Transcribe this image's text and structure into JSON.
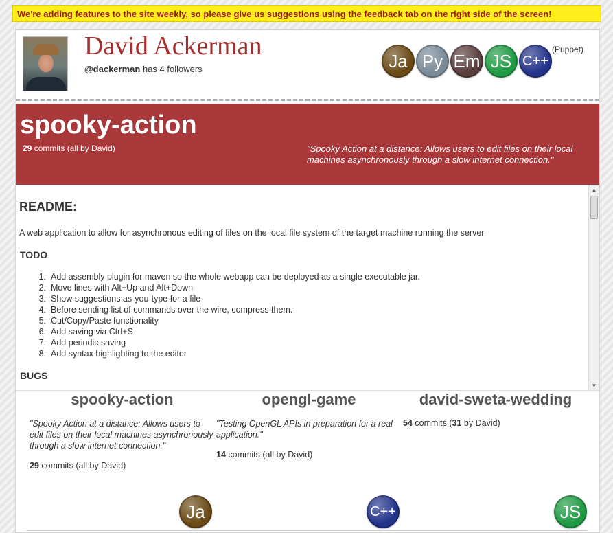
{
  "banner": {
    "text": "We're adding features to the site weekly, so please give us suggestions using the feedback tab on the right side of the screen!"
  },
  "profile": {
    "name": "David Ackerman",
    "handle": "@dackerman",
    "followers_text": " has 4 followers",
    "languages": [
      {
        "abbr": "Ja",
        "color": "#6b4a16"
      },
      {
        "abbr": "Py",
        "color": "#7a8a97"
      },
      {
        "abbr": "Em",
        "color": "#5a3e3e"
      },
      {
        "abbr": "JS",
        "color": "#1f9a44"
      },
      {
        "abbr": "C++",
        "color": "#23338a"
      }
    ],
    "extra_language": "(Puppet)"
  },
  "repo": {
    "title": "spooky-action",
    "commit_count": "29",
    "commits_text": " commits (all by David)",
    "description": "\"Spooky Action at a distance: Allows users to edit files on their local machines asynchronously through a slow internet connection.\""
  },
  "readme": {
    "heading": "README:",
    "intro": "A web application to allow for asynchronous editing of files on the local file system of the target machine running the server",
    "todo_heading": "TODO",
    "todo_items": [
      "Add assembly plugin for maven so the whole webapp can be deployed as a single executable jar.",
      "Move lines with Alt+Up and Alt+Down",
      "Show suggestions as-you-type for a file",
      "Before sending list of commands over the wire, compress them.",
      "Cut/Copy/Paste functionality",
      "Add saving via Ctrl+S",
      "Add periodic saving",
      "Add syntax highlighting to the editor"
    ],
    "bugs_heading": "BUGS"
  },
  "repo_cards": [
    {
      "title": "spooky-action",
      "description": "\"Spooky Action at a distance: Allows users to edit files on their local machines asynchronously through a slow internet connection.\"",
      "commit_count": "29",
      "commits_text": " commits (all by David)",
      "language": {
        "abbr": "Ja",
        "color": "#6b4a16"
      }
    },
    {
      "title": "opengl-game",
      "description": "\"Testing OpenGL APIs in preparation for a real application.\"",
      "commit_count": "14",
      "commits_text": " commits (all by David)",
      "language": {
        "abbr": "C++",
        "color": "#23338a"
      }
    },
    {
      "title": "david-sweta-wedding",
      "description": "",
      "commit_count": "54",
      "commits_mid": " commits (",
      "commits_by": "31",
      "commits_tail": " by David)",
      "language": {
        "abbr": "JS",
        "color": "#1f9a44"
      }
    }
  ]
}
